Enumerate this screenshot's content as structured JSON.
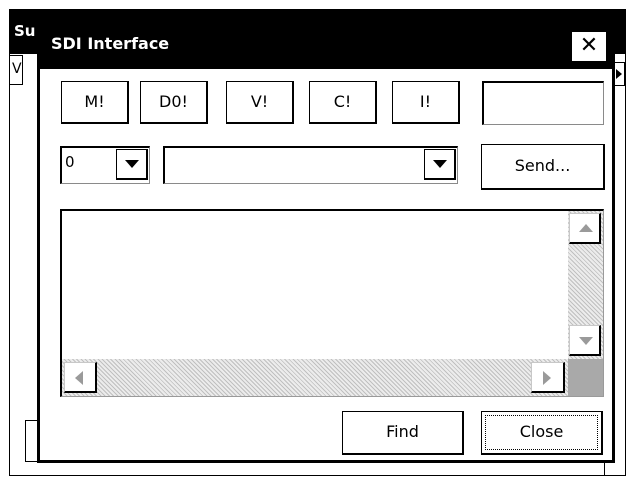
{
  "background_window": {
    "title_fragment": "Su",
    "tab_fragment": "V"
  },
  "dialog": {
    "title": "SDI Interface",
    "close_glyph": "✕"
  },
  "command_buttons": [
    {
      "label": "M!"
    },
    {
      "label": "D0!"
    },
    {
      "label": "V!"
    },
    {
      "label": "C!"
    },
    {
      "label": "I!"
    }
  ],
  "response_field": {
    "value": ""
  },
  "address_select": {
    "value": "0"
  },
  "command_select": {
    "value": ""
  },
  "send_button": {
    "label": "Send..."
  },
  "output_pane": {
    "text": ""
  },
  "footer": {
    "find_label": "Find",
    "close_label": "Close"
  },
  "colors": {
    "titlebar": "#000000",
    "window": "#ffffff",
    "scroll_track": "#ececec",
    "scroll_arrow_disabled": "#9a9a9a",
    "scroll_corner": "#a9a9a9"
  },
  "icons": {
    "close": "close-icon",
    "dropdown": "chevron-down-icon",
    "scroll_up": "arrow-up-icon",
    "scroll_down": "arrow-down-icon",
    "scroll_left": "arrow-left-icon",
    "scroll_right": "arrow-right-icon"
  }
}
